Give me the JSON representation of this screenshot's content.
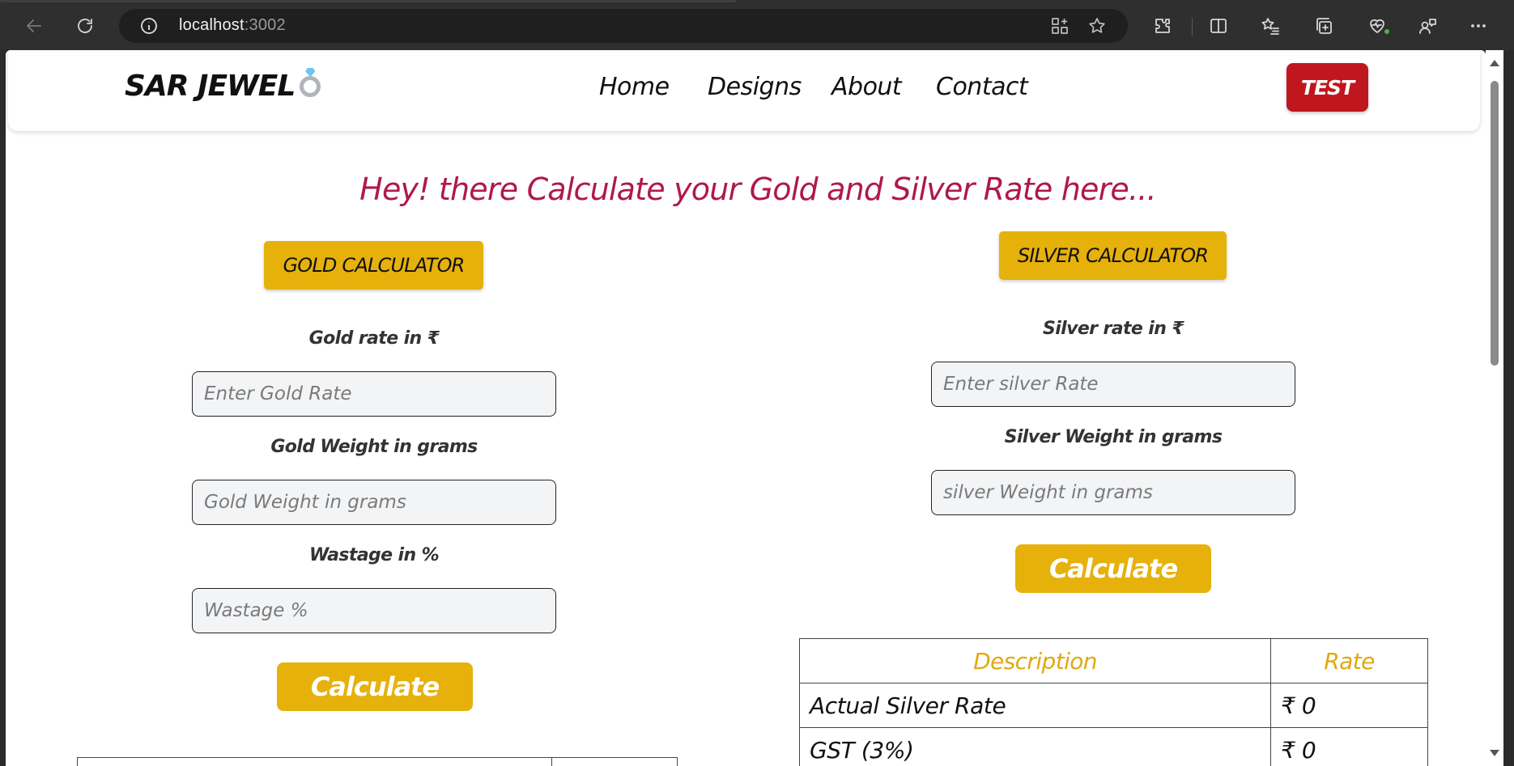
{
  "browser": {
    "url_host": "localhost",
    "url_port": ":3002"
  },
  "navbar": {
    "brand": "SAR JEWEL",
    "links": [
      "Home",
      "Designs",
      "About",
      "Contact"
    ],
    "test_button": "TEST"
  },
  "headline": "Hey! there Calculate your Gold and Silver Rate here...",
  "gold": {
    "title": "GOLD CALCULATOR",
    "rate_label": "Gold rate in ₹",
    "rate_placeholder": "Enter Gold Rate",
    "weight_label": "Gold Weight in grams",
    "weight_placeholder": "Gold Weight in grams",
    "wastage_label": "Wastage in %",
    "wastage_placeholder": "Wastage %",
    "calculate": "Calculate"
  },
  "silver": {
    "title": "SILVER CALCULATOR",
    "rate_label": "Silver rate in ₹",
    "rate_placeholder": "Enter silver Rate",
    "weight_label": "Silver Weight in grams",
    "weight_placeholder": "silver Weight in grams",
    "calculate": "Calculate",
    "table": {
      "headers": [
        "Description",
        "Rate"
      ],
      "rows": [
        [
          "Actual Silver Rate",
          "₹ 0"
        ],
        [
          "GST (3%)",
          "₹ 0"
        ]
      ]
    }
  },
  "colors": {
    "accent_gold": "#e6b10b",
    "headline": "#b0184c",
    "test_button": "#c0161d"
  }
}
